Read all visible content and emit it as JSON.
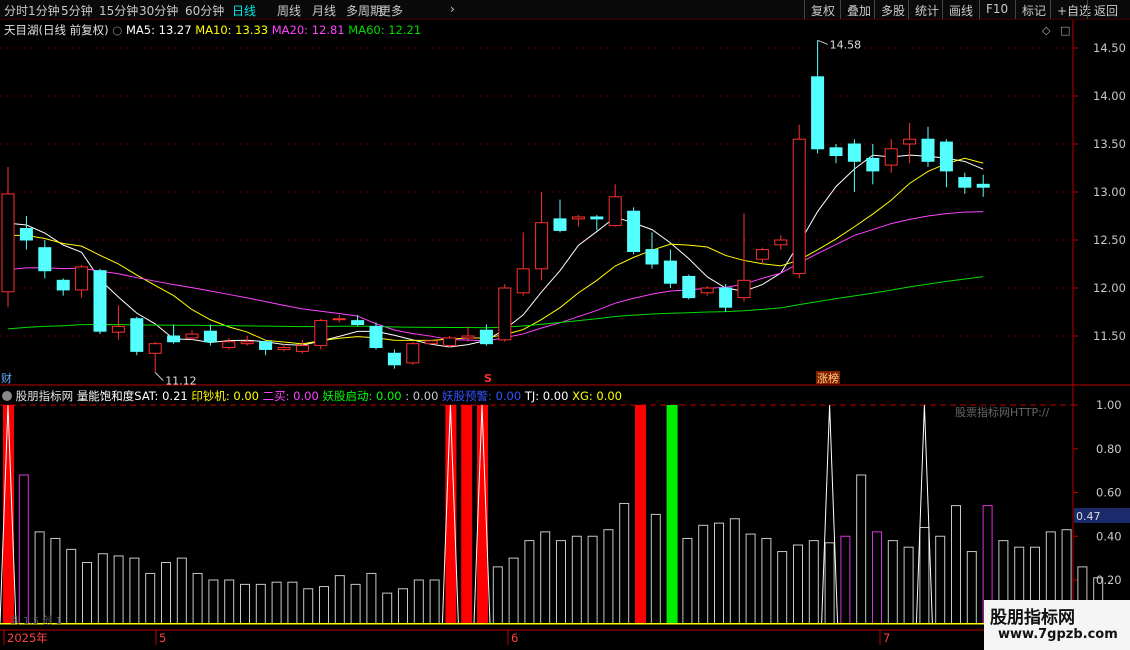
{
  "toolbar": {
    "periods": [
      "分时",
      "1分钟",
      "5分钟",
      "15分钟",
      "30分钟",
      "60分钟",
      "日线",
      "周线",
      "月线",
      "多周期",
      "更多"
    ],
    "active_period": "日线",
    "right_buttons": [
      "复权",
      "叠加",
      "多股",
      "统计",
      "画线",
      "F10",
      "标记",
      "+自选",
      "返回"
    ]
  },
  "main_chart": {
    "stock_title": "天目湖(日线 前复权)",
    "ma_legend": [
      {
        "label": "MA5: 13.27",
        "color": "#ffffff"
      },
      {
        "label": "MA10: 13.33",
        "color": "#ffff00"
      },
      {
        "label": "MA20: 12.81",
        "color": "#ff44ff"
      },
      {
        "label": "MA60: 12.21",
        "color": "#00dd00"
      }
    ],
    "price_ticks": [
      "14.50",
      "14.00",
      "13.50",
      "13.00",
      "12.50",
      "12.00",
      "11.50"
    ],
    "high_label": "14.58",
    "low_label": "11.12",
    "left_tag": "财",
    "mid_tag": "S",
    "limit_tag": "涨榜"
  },
  "indicator": {
    "title": "股朋指标网",
    "legend": [
      {
        "label": "量能饱和度SAT: 0.21",
        "color": "#ffffff"
      },
      {
        "label": "印钞机: 0.00",
        "color": "#ffff00"
      },
      {
        "label": "二买: 0.00",
        "color": "#ff44ff"
      },
      {
        "label": "妖股启动: 0.00",
        "color": "#00ff00"
      },
      {
        "label": ": 0.00",
        "color": "#c8c8c8"
      },
      {
        "label": "妖股预警: 0.00",
        "color": "#3355ff"
      },
      {
        "label": "TJ: 0.00",
        "color": "#ffffff"
      },
      {
        "label": "XG: 0.00",
        "color": "#ffff00"
      }
    ],
    "ticks": [
      "1.00",
      "0.80",
      "0.60",
      "0.40",
      "0.20"
    ],
    "current_value": "0.47",
    "watermark_text": "股票指标网HTTP://",
    "bottom_hint": "到 1.5 创 1",
    "sat_values": [
      1,
      0.68,
      0.42,
      0.39,
      0.34,
      0.28,
      0.32,
      0.31,
      0.3,
      0.23,
      0.28,
      0.3,
      0.23,
      0.2,
      0.2,
      0.18,
      0.18,
      0.19,
      0.19,
      0.16,
      0.17,
      0.22,
      0.18,
      0.23,
      0.14,
      0.16,
      0.2,
      0.2,
      0.29,
      0.24,
      0.21,
      0.26,
      0.3,
      0.38,
      0.42,
      0.38,
      0.4,
      0.4,
      0.43,
      0.55,
      0.52,
      0.5,
      0.47,
      0.39,
      0.45,
      0.46,
      0.48,
      0.41,
      0.39,
      0.33,
      0.36,
      0.38,
      0.37,
      0.4,
      0.68,
      0.42,
      0.38,
      0.35,
      0.44,
      0.4,
      0.54,
      0.33,
      0.54,
      0.38,
      0.35,
      0.35,
      0.42,
      0.43,
      0.26,
      0.21
    ],
    "sat_magenta": [
      1,
      28,
      29,
      30,
      40,
      53,
      55,
      62
    ],
    "red_bars": [
      0,
      28,
      29,
      30,
      40
    ],
    "green_bars": [
      42
    ]
  },
  "xaxis": {
    "labels": [
      {
        "text": "2025年"
      },
      {
        "text": "5"
      },
      {
        "text": "6"
      },
      {
        "text": "7"
      }
    ]
  },
  "brand": {
    "line1": "股朋指标网",
    "line2": "www.7gpzb.com"
  }
}
